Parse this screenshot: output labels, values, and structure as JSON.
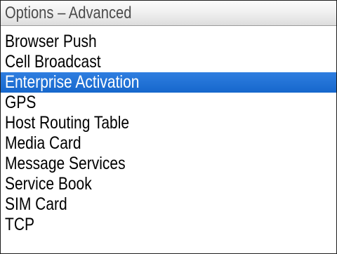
{
  "screen": {
    "title": "Options – Advanced"
  },
  "options": {
    "selected_index": 2,
    "items": [
      {
        "label": "Browser Push"
      },
      {
        "label": "Cell Broadcast"
      },
      {
        "label": "Enterprise Activation"
      },
      {
        "label": "GPS"
      },
      {
        "label": "Host Routing Table"
      },
      {
        "label": "Media Card"
      },
      {
        "label": "Message Services"
      },
      {
        "label": "Service Book"
      },
      {
        "label": "SIM Card"
      },
      {
        "label": "TCP"
      }
    ]
  },
  "colors": {
    "selection": "#1f6fd1",
    "selection_text": "#ffffff",
    "text": "#000000",
    "title_text": "#4b4b4b",
    "background": "#ffffff"
  }
}
